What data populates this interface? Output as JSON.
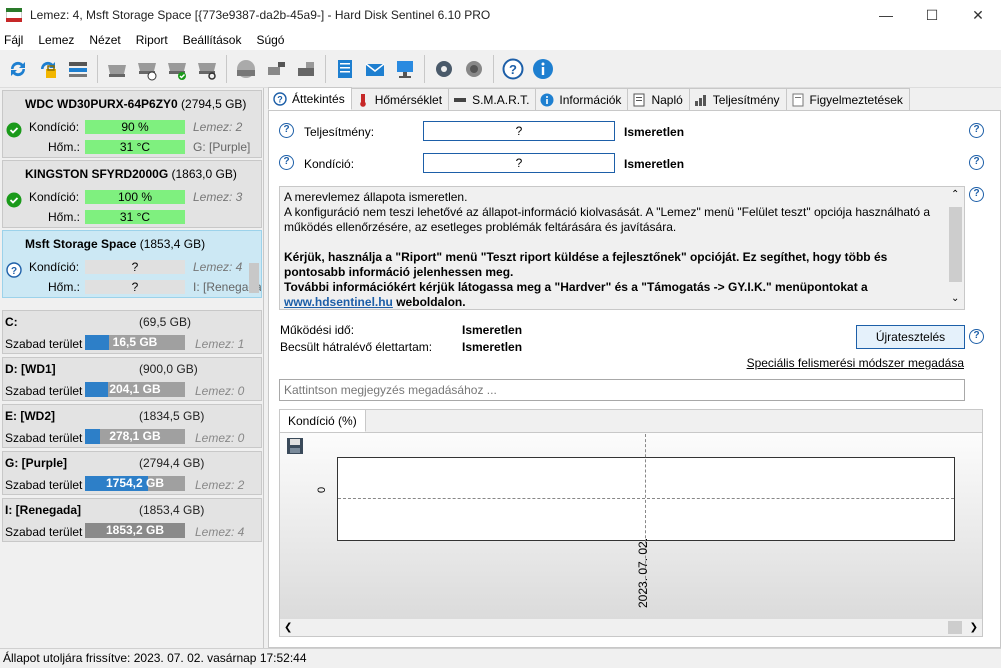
{
  "window": {
    "title": "Lemez: 4, Msft    Storage Space [{773e9387-da2b-45a9-]  -  Hard Disk Sentinel 6.10 PRO",
    "minimize": "—",
    "maximize": "☐",
    "close": "✕"
  },
  "menu": [
    "Fájl",
    "Lemez",
    "Nézet",
    "Riport",
    "Beállítások",
    "Súgó"
  ],
  "toolbar_icons": [
    "refresh-icon",
    "refresh-lock-icon",
    "disk-list-icon",
    "disk-hdd-icon",
    "disk-schedule-icon",
    "disk-check-icon",
    "disk-search-icon",
    "disk-gray-icon",
    "disk-network-icon",
    "disk-export-icon",
    "report-icon",
    "mail-icon",
    "network-share-icon",
    "settings-icon",
    "sound-icon",
    "help-icon",
    "info-icon"
  ],
  "disks": [
    {
      "title_bold": "WDC WD30PURX-64P6ZY0",
      "title_size": " (2794,5 GB)",
      "status": "ok",
      "condition_label": "Kondíció:",
      "condition_value": "90 %",
      "condition_side": "Lemez: 2",
      "temp_label": "Hőm.:",
      "temp_value": "31 °C",
      "temp_side": "G: [Purple]"
    },
    {
      "title_bold": "KINGSTON SFYRD2000G",
      "title_size": " (1863,0 GB)",
      "status": "ok",
      "condition_label": "Kondíció:",
      "condition_value": "100 %",
      "condition_side": "Lemez: 3",
      "temp_label": "Hőm.:",
      "temp_value": "31 °C",
      "temp_side": ""
    },
    {
      "title_bold": "Msft    Storage Space",
      "title_size": " (1853,4 GB)",
      "status": "unknown",
      "condition_label": "Kondíció:",
      "condition_value": "?",
      "condition_side": "Lemez: 4",
      "temp_label": "Hőm.:",
      "temp_value": "?",
      "temp_side": "I: [Renegada]"
    }
  ],
  "volumes": [
    {
      "name": "C:",
      "size": "(69,5 GB)",
      "free_label": "Szabad terület",
      "free_value": "16,5 GB",
      "free_fraction": 0.24,
      "disk": "Lemez: 1"
    },
    {
      "name": "D: [WD1]",
      "size": "(900,0 GB)",
      "free_label": "Szabad terület",
      "free_value": "204,1 GB",
      "free_fraction": 0.23,
      "disk": "Lemez: 0"
    },
    {
      "name": "E: [WD2]",
      "size": "(1834,5 GB)",
      "free_label": "Szabad terület",
      "free_value": "278,1 GB",
      "free_fraction": 0.15,
      "disk": "Lemez: 0"
    },
    {
      "name": "G: [Purple]",
      "size": "(2794,4 GB)",
      "free_label": "Szabad terület",
      "free_value": "1754,2 GB",
      "free_fraction": 0.63,
      "disk": "Lemez: 2"
    },
    {
      "name": "I: [Renegada]",
      "size": "(1853,4 GB)",
      "free_label": "Szabad terület",
      "free_value": "1853,2 GB",
      "free_fraction": 1.0,
      "disk": "Lemez: 4"
    }
  ],
  "tabs": [
    {
      "label": "Áttekintés",
      "icon": "help-circle-icon"
    },
    {
      "label": "Hőmérséklet",
      "icon": "thermometer-icon"
    },
    {
      "label": "S.M.A.R.T.",
      "icon": "disk-icon"
    },
    {
      "label": "Információk",
      "icon": "info-icon"
    },
    {
      "label": "Napló",
      "icon": "log-icon"
    },
    {
      "label": "Teljesítmény",
      "icon": "performance-icon"
    },
    {
      "label": "Figyelmeztetések",
      "icon": "alerts-icon"
    }
  ],
  "overview": {
    "performance_label": "Teljesítmény:",
    "performance_box": "?",
    "performance_value": "Ismeretlen",
    "condition_label": "Kondíció:",
    "condition_box": "?",
    "condition_value": "Ismeretlen",
    "message_lines": [
      "A merevlemez állapota ismeretlen.",
      "A konfiguráció nem teszi lehetővé az állapot-információ kiolvasását. A \"Lemez\" menü \"Felület teszt\" opciója használható a működés ellenőrzésére, az esetleges problémák feltárására és javítására.",
      "Kérjük, használja a \"Riport\" menü \"Teszt riport küldése a fejlesztőnek\" opcióját. Ez segíthet, hogy több és pontosabb információ jelenhessen meg.",
      "További információkért kérjük látogassa meg a \"Hardver\" és a \"Támogatás -> GY.I.K.\" menüpontokat a",
      "www.hdsentinel.hu",
      " weboldalon."
    ],
    "uptime_label": "Működési idő:",
    "uptime_value": "Ismeretlen",
    "remaining_label": "Becsült hátralévő élettartam:",
    "remaining_value": "Ismeretlen",
    "retest_button": "Újratesztelés",
    "special_link": "Speciális felismerési módszer megadása",
    "comment_placeholder": "Kattintson megjegyzés megadásához ..."
  },
  "chart_tab": "Kondíció  (%)",
  "chart_data": {
    "type": "line",
    "title": "Kondíció  (%)",
    "x": [
      "2023. 07. 02."
    ],
    "series": [
      {
        "values": [
          0
        ]
      }
    ],
    "yticks": [
      "0"
    ],
    "grid": false
  },
  "status": "Állapot utoljára frissítve: 2023. 07. 02. vasárnap 17:52:44"
}
